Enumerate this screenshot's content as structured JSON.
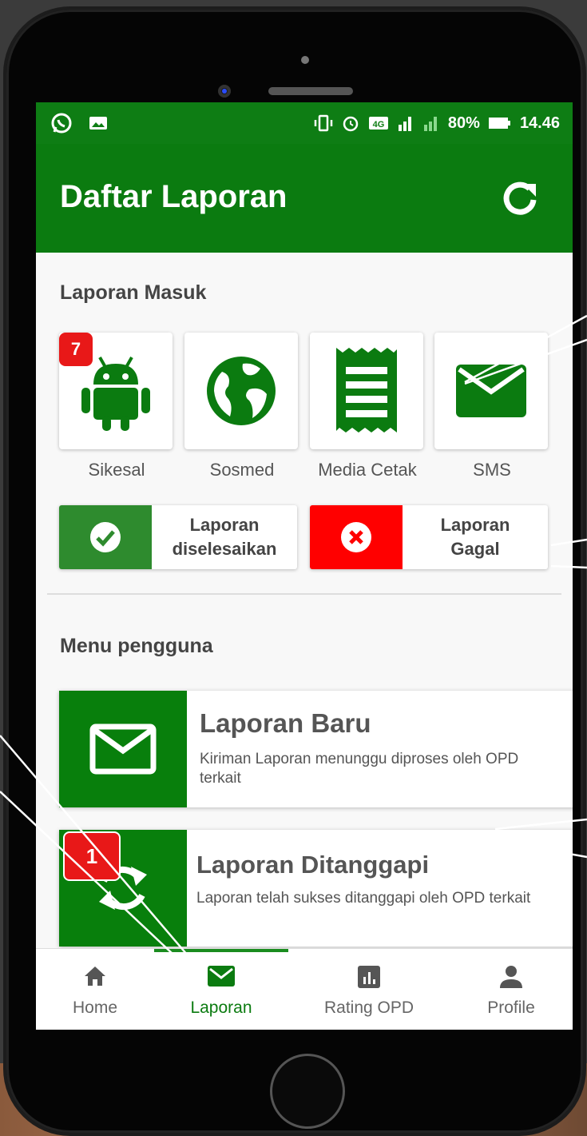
{
  "status_bar": {
    "left_icons": [
      "whatsapp-icon",
      "image-icon"
    ],
    "right_icons": [
      "vibrate-icon",
      "alarm-icon",
      "network-4g-icon",
      "signal-sim1-icon",
      "signal-sim2-icon"
    ],
    "battery": "80%",
    "time": "14.46"
  },
  "app_bar": {
    "title": "Daftar Laporan",
    "action_icon": "refresh-icon"
  },
  "incoming": {
    "title": "Laporan Masuk",
    "sources": [
      {
        "label": "Sikesal",
        "icon": "android-icon",
        "badge": "7"
      },
      {
        "label": "Sosmed",
        "icon": "globe-icon"
      },
      {
        "label": "Media Cetak",
        "icon": "receipt-icon"
      },
      {
        "label": "SMS",
        "icon": "envelope-icon"
      }
    ]
  },
  "status_cards": [
    {
      "label_line1": "Laporan",
      "label_line2": "diselesaikan",
      "icon": "check-circle-icon",
      "color": "#2e8b2e"
    },
    {
      "label_line1": "Laporan",
      "label_line2": "Gagal",
      "icon": "close-circle-icon",
      "color": "#ff0000"
    }
  ],
  "user_menu": {
    "title": "Menu pengguna",
    "items": [
      {
        "title": "Laporan Baru",
        "desc": "Kiriman Laporan menunggu diproses oleh OPD terkait",
        "icon": "envelope-outline-icon"
      },
      {
        "title": "Laporan Ditanggapi",
        "desc": "Laporan telah sukses ditanggapi oleh OPD terkait",
        "icon": "sync-icon",
        "badge": "1"
      }
    ]
  },
  "bottom_nav": {
    "active_index": 1,
    "items": [
      {
        "label": "Home",
        "icon": "home-icon"
      },
      {
        "label": "Laporan",
        "icon": "mail-icon"
      },
      {
        "label": "Rating OPD",
        "icon": "bar-chart-icon"
      },
      {
        "label": "Profile",
        "icon": "person-icon"
      }
    ]
  },
  "colors": {
    "primary": "#0b7b10",
    "accent_green": "#2e8b2e",
    "error": "#ff0000",
    "badge": "#e81818"
  }
}
